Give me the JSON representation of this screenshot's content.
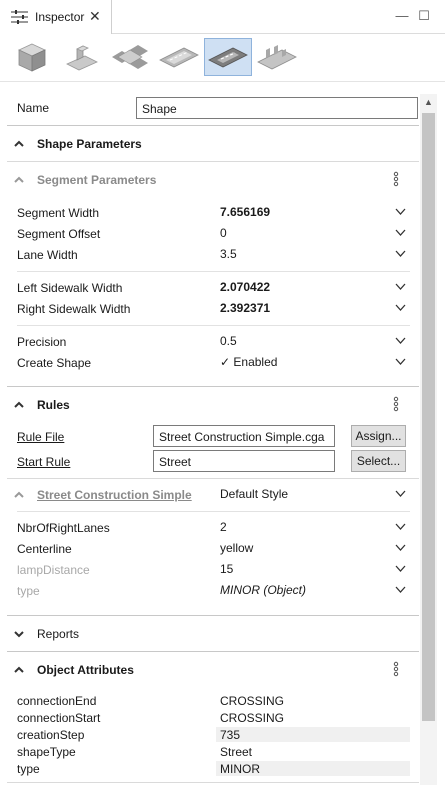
{
  "tab": {
    "title": "Inspector",
    "close_glyph": "✕",
    "icon": "sliders-icon"
  },
  "window": {
    "minimize_glyph": "—",
    "maximize_glyph": "☐"
  },
  "toolbar": {
    "tools": [
      {
        "name": "cube-icon",
        "active": false
      },
      {
        "name": "shape-extrude-icon",
        "active": false
      },
      {
        "name": "crossing-icon",
        "active": false
      },
      {
        "name": "street-segment-icon",
        "active": false
      },
      {
        "name": "shape-parameters-icon",
        "active": true
      },
      {
        "name": "street-shape-icon",
        "active": false
      }
    ]
  },
  "name_row": {
    "label": "Name",
    "value": "Shape"
  },
  "shape_parameters": {
    "title": "Shape Parameters",
    "segment_parameters": {
      "title": "Segment Parameters",
      "rows": [
        {
          "label": "Segment Width",
          "value": "7.656169",
          "bold": true
        },
        {
          "label": "Segment Offset",
          "value": "0",
          "bold": false
        },
        {
          "label": "Lane Width",
          "value": "3.5",
          "bold": false
        },
        {
          "label": "Left Sidewalk Width",
          "value": "2.070422",
          "bold": true
        },
        {
          "label": "Right Sidewalk Width",
          "value": "2.392371",
          "bold": true
        },
        {
          "label": "Precision",
          "value": "0.5",
          "bold": false
        },
        {
          "label": "Create Shape",
          "value": "✓ Enabled",
          "bold": false
        }
      ]
    }
  },
  "rules": {
    "title": "Rules",
    "rule_file": {
      "label": "Rule File",
      "value": "Street Construction Simple.cga",
      "button": "Assign..."
    },
    "start_rule": {
      "label": "Start Rule",
      "value": "Street",
      "button": "Select..."
    },
    "style_section": {
      "title": "Street Construction Simple",
      "style_value": "Default Style",
      "rows": [
        {
          "label": "NbrOfRightLanes",
          "value": "2",
          "dim": false,
          "italic": false
        },
        {
          "label": "Centerline",
          "value": "yellow",
          "dim": false,
          "italic": false
        },
        {
          "label": "lampDistance",
          "value": "15",
          "dim": true,
          "italic": false
        },
        {
          "label": "type",
          "value": "MINOR (Object)",
          "dim": true,
          "italic": true
        }
      ]
    }
  },
  "reports": {
    "title": "Reports"
  },
  "object_attributes": {
    "title": "Object Attributes",
    "rows": [
      {
        "label": "connectionEnd",
        "value": "CROSSING"
      },
      {
        "label": "connectionStart",
        "value": "CROSSING"
      },
      {
        "label": "creationStep",
        "value": "735"
      },
      {
        "label": "shapeType",
        "value": "Street"
      },
      {
        "label": "type",
        "value": "MINOR"
      }
    ]
  },
  "colors": {
    "accent": "#cfe0f3",
    "accent_border": "#8fb3dc",
    "separator": "#dadada",
    "dim_text": "#a8a8a8"
  }
}
